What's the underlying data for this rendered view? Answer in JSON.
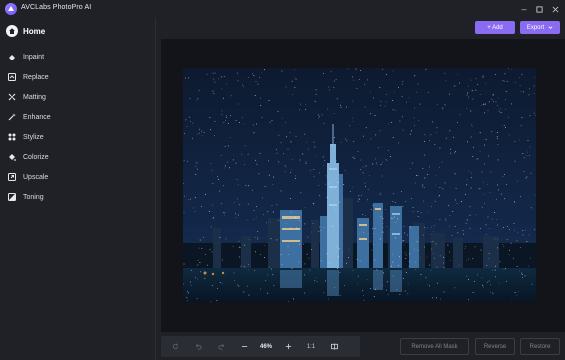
{
  "app": {
    "title": "AVCLabs PhotoPro AI"
  },
  "window_controls": {
    "minimize": "–",
    "maximize": "☐",
    "close": "✕"
  },
  "sidebar": {
    "home_label": "Home",
    "items": [
      {
        "label": "Inpaint",
        "icon": "eraser-icon"
      },
      {
        "label": "Replace",
        "icon": "replace-icon"
      },
      {
        "label": "Matting",
        "icon": "matting-icon"
      },
      {
        "label": "Enhance",
        "icon": "enhance-icon"
      },
      {
        "label": "Stylize",
        "icon": "stylize-icon"
      },
      {
        "label": "Colorize",
        "icon": "colorize-icon"
      },
      {
        "label": "Upscale",
        "icon": "upscale-icon"
      },
      {
        "label": "Toning",
        "icon": "toning-icon"
      }
    ]
  },
  "toolbar": {
    "add_label": "+ Add",
    "export_label": "Export"
  },
  "bottom": {
    "zoom": "46%",
    "one_to_one": "1:1",
    "remove_all_mask": "Remove All Mask",
    "reverse": "Reverse",
    "restore": "Restore"
  },
  "colors": {
    "accent": "#8a6cf3",
    "background": "#1f2126",
    "canvas": "#121419"
  }
}
